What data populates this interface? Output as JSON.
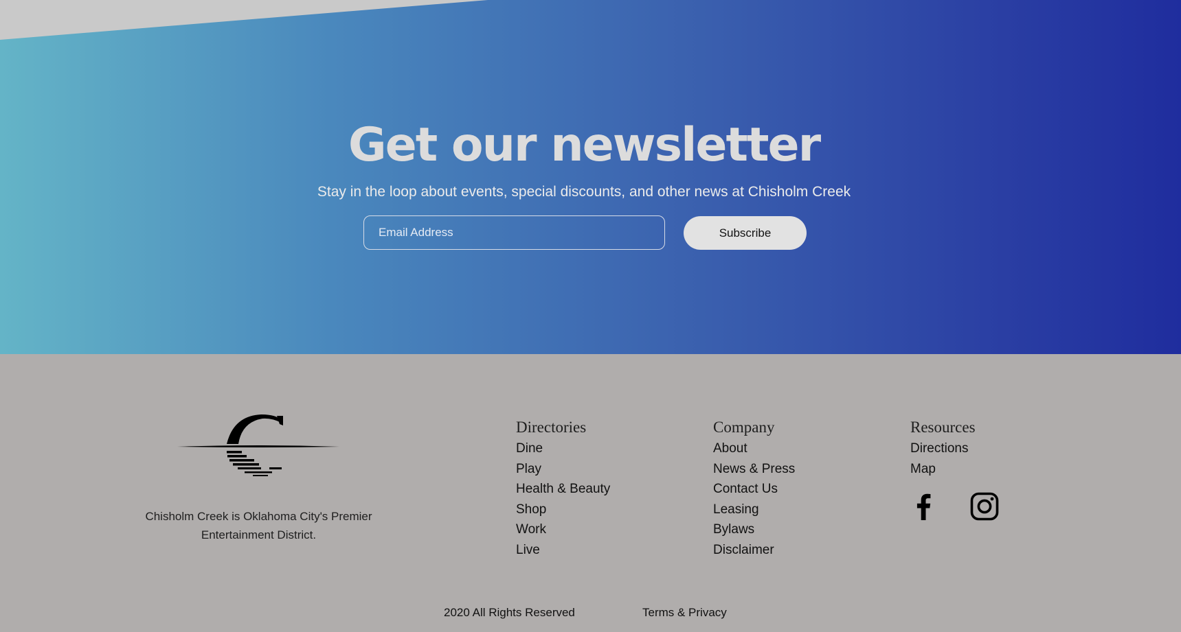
{
  "newsletter": {
    "title": "Get our newsletter",
    "subtitle": "Stay in the loop about events, special discounts, and other news at Chisholm Creek",
    "email_placeholder": "Email Address",
    "subscribe_label": "Subscribe"
  },
  "footer": {
    "logo_icon": "chisholm-creek-logo",
    "tagline": "Chisholm Creek is Oklahoma City's Premier Entertainment District.",
    "columns": [
      {
        "heading": "Directories",
        "links": [
          "Dine",
          "Play",
          "Health & Beauty",
          "Shop",
          "Work",
          "Live"
        ]
      },
      {
        "heading": "Company",
        "links": [
          "About",
          "News & Press",
          "Contact Us",
          "Leasing",
          "Bylaws",
          "Disclaimer"
        ]
      },
      {
        "heading": "Resources",
        "links": [
          "Directions",
          "Map"
        ]
      }
    ],
    "social": [
      "facebook-icon",
      "instagram-icon"
    ],
    "copyright": "2020 All Rights Reserved",
    "terms_label": "Terms & Privacy"
  },
  "colors": {
    "gradient_start": "#64b4c7",
    "gradient_end": "#1f2d9e",
    "footer_background": "#b0adac",
    "subscribe_button": "#e2e2e2",
    "title_text": "#dcdcdc"
  }
}
